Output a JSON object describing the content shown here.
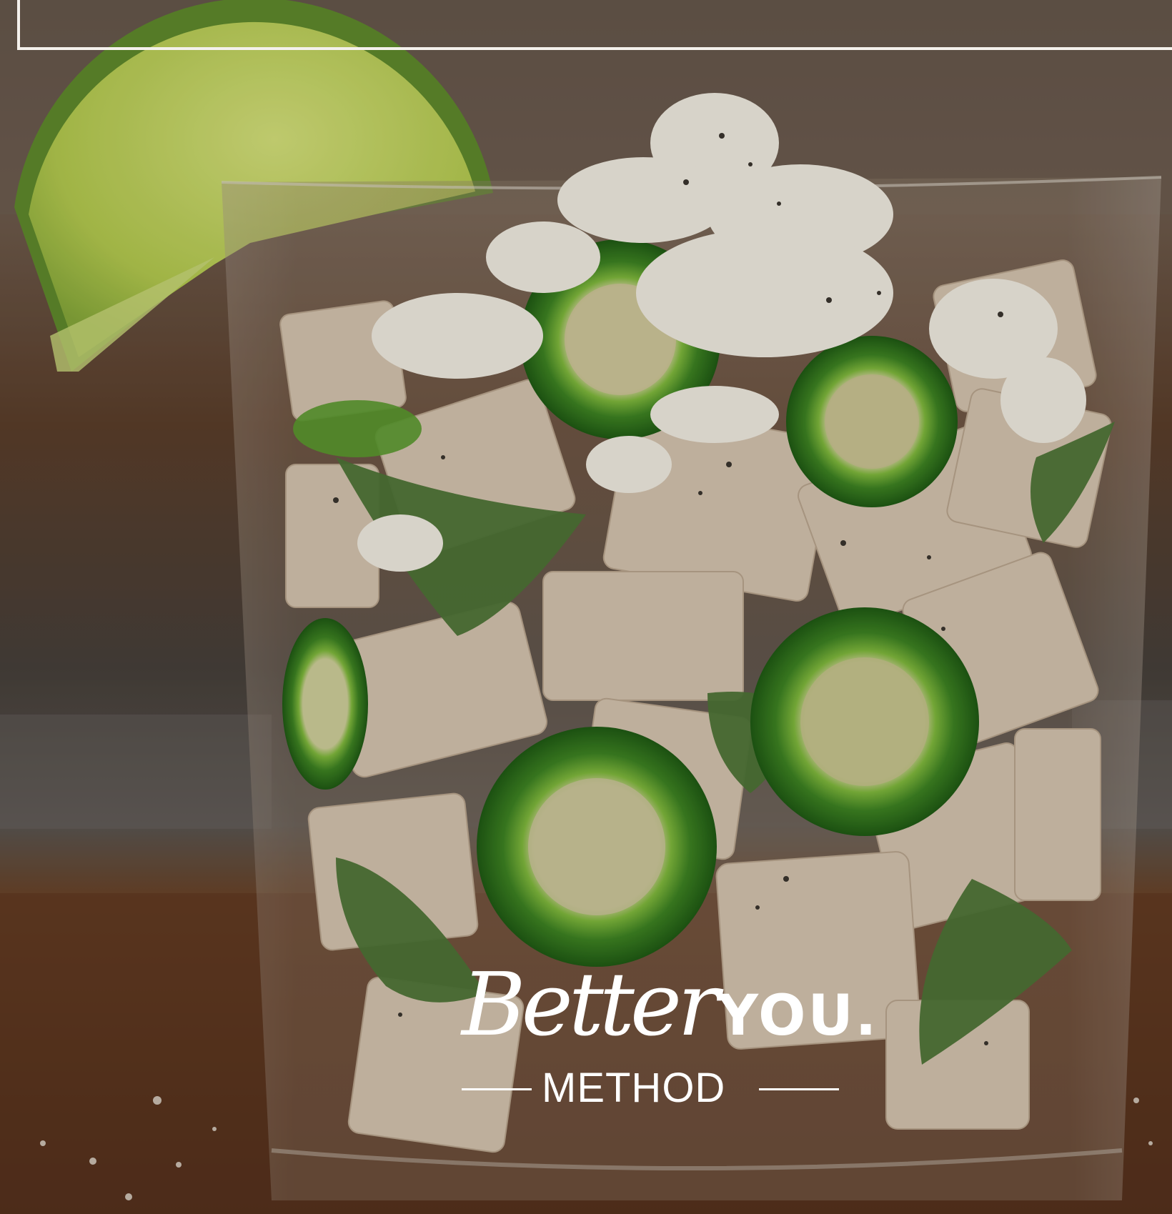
{
  "logo": {
    "better": "Better",
    "you": "YOU.",
    "method": "METHOD"
  },
  "colors": {
    "frame": "#f4f1ec",
    "logo_text": "#ffffff",
    "lime": "#b7cf54",
    "jalapeno": "#3f8a24",
    "mint": "#4f7a3a",
    "palm_heart": "#d9c9b6",
    "cheese": "#f1ece2",
    "wood": "#6a3d1f"
  }
}
